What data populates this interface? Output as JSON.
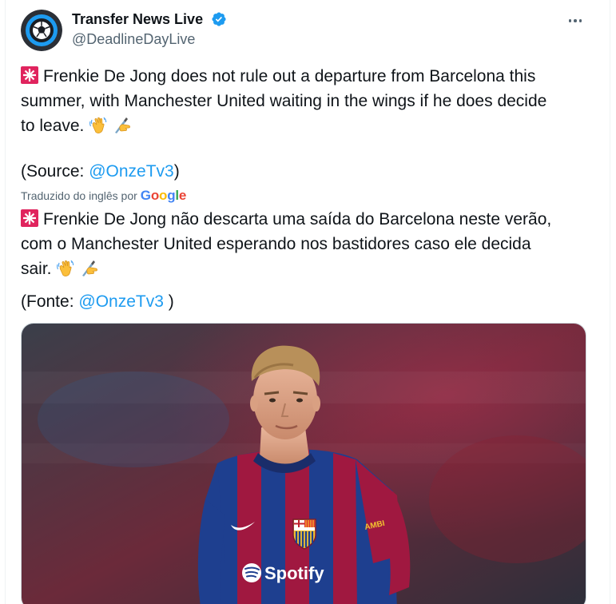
{
  "account": {
    "name": "Transfer News Live",
    "handle": "@DeadlineDayLive",
    "verified_color": "#1d9bf0"
  },
  "tweet": {
    "line1": "Frenkie De Jong does not rule out a departure from Barcelona this",
    "line2": "summer, with Manchester United waiting in the wings if he does decide",
    "line3": "to leave.",
    "source_prefix": "(Source: ",
    "source_link": "@OnzeTv3",
    "source_suffix": ")"
  },
  "translation": {
    "label": "Traduzido do inglês por",
    "provider": "Google",
    "line1": "Frenkie De Jong não descarta uma saída do Barcelona neste verão,",
    "line2": "com o Manchester United esperando nos bastidores caso ele decida",
    "line3": "sair.",
    "source_prefix": "(Fonte: ",
    "source_link": "@OnzeTv3",
    "source_suffix": " )"
  },
  "media": {
    "sponsor": "Spotify",
    "shirt_text": "AMBI"
  },
  "icons": [
    "siren-icon",
    "waving-hand-icon",
    "writing-hand-icon",
    "verified-badge-icon",
    "more-options-icon"
  ]
}
